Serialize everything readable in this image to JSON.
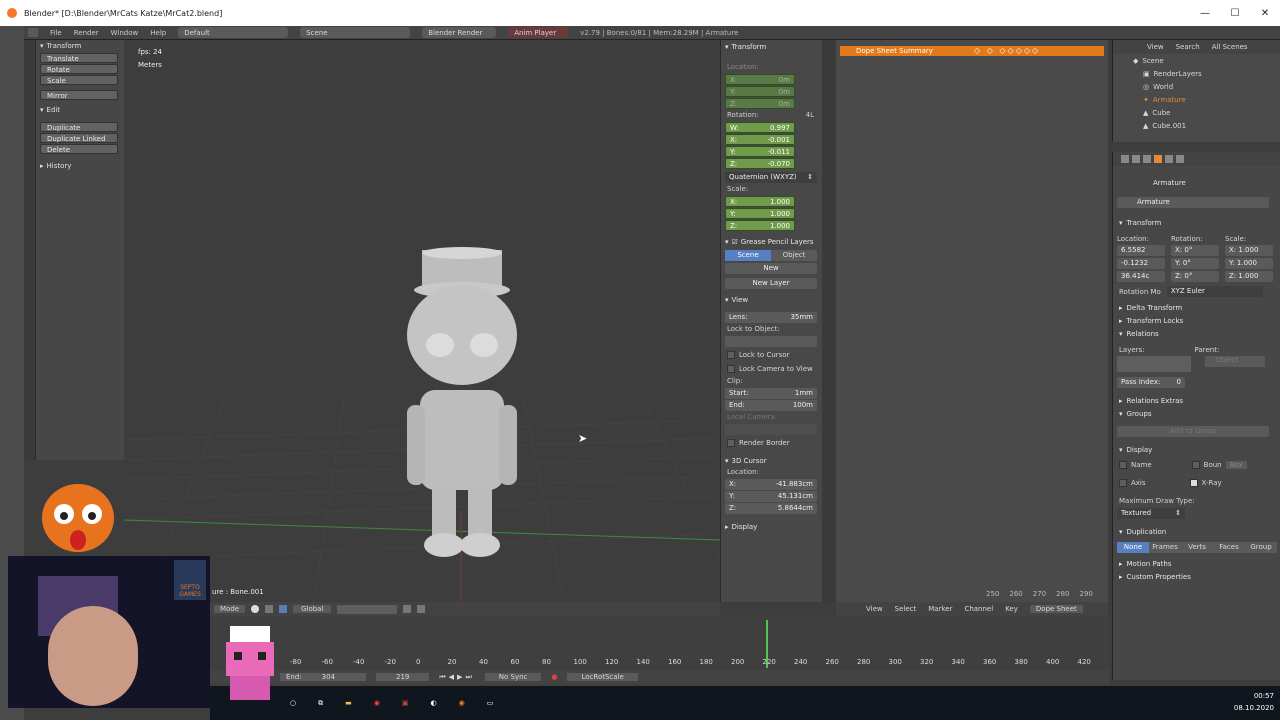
{
  "window": {
    "title": "Blender* [D:\\Blender\\MrCats Katze\\MrCat2.blend]",
    "min": "—",
    "max": "☐",
    "close": "✕"
  },
  "header": {
    "menus": [
      "File",
      "Render",
      "Window",
      "Help"
    ],
    "layout": "Default",
    "scene": "Scene",
    "engine": "Blender Render",
    "anim_player": "Anim Player",
    "stats": "v2.79 | Bones:0/81 | Mem:28.29M | Armature"
  },
  "toolshelf": {
    "transform_title": "Transform",
    "transform_buttons": [
      "Translate",
      "Rotate",
      "Scale"
    ],
    "mirror": "Mirror",
    "edit_title": "Edit",
    "edit_buttons": [
      "Duplicate",
      "Duplicate Linked",
      "Delete"
    ],
    "history_title": "History"
  },
  "viewport": {
    "fps": "fps: 24",
    "units": "Meters",
    "bone_label": "ure : Bone.001",
    "mode": "Mode",
    "orientation": "Global"
  },
  "npanel": {
    "transform_title": "Transform",
    "location_label": "Location:",
    "location": [
      {
        "k": "X:",
        "v": "0m"
      },
      {
        "k": "Y:",
        "v": "0m"
      },
      {
        "k": "Z:",
        "v": "0m"
      }
    ],
    "rotation_label": "Rotation:",
    "rotation_4l": "4L",
    "rotation": [
      {
        "k": "W:",
        "v": "0.997"
      },
      {
        "k": "X:",
        "v": "-0.001"
      },
      {
        "k": "Y:",
        "v": "-0.011"
      },
      {
        "k": "Z:",
        "v": "-0.070"
      }
    ],
    "rotation_mode": "Quaternion (WXYZ)",
    "scale_label": "Scale:",
    "scale": [
      {
        "k": "X:",
        "v": "1.000"
      },
      {
        "k": "Y:",
        "v": "1.000"
      },
      {
        "k": "Z:",
        "v": "1.000"
      }
    ],
    "grease_title": "Grease Pencil Layers",
    "grease_scene": "Scene",
    "grease_object": "Object",
    "grease_new": "New",
    "grease_new_layer": "New Layer",
    "view_title": "View",
    "lens_label": "Lens:",
    "lens_value": "35mm",
    "lock_object": "Lock to Object:",
    "lock_cursor": "Lock to Cursor",
    "lock_camera": "Lock Camera to View",
    "clip_label": "Clip:",
    "clip_start_label": "Start:",
    "clip_start": "1mm",
    "clip_end_label": "End:",
    "clip_end": "100m",
    "local_camera": "Local Camera:",
    "render_border": "Render Border",
    "cursor_title": "3D Cursor",
    "cursor_location": "Location:",
    "cursor": [
      {
        "k": "X:",
        "v": "-41.883cm"
      },
      {
        "k": "Y:",
        "v": "45.131cm"
      },
      {
        "k": "Z:",
        "v": "5.8644cm"
      }
    ],
    "display_title": "Display"
  },
  "dopesheet": {
    "summary": "Dope Sheet Summary",
    "ruler": [
      "250",
      "260",
      "270",
      "280",
      "290"
    ],
    "menus": [
      "View",
      "Select",
      "Marker",
      "Channel",
      "Key"
    ],
    "mode": "Dope Sheet"
  },
  "outliner": {
    "menus": [
      "View",
      "Search",
      "All Scenes"
    ],
    "items": [
      "Scene",
      "RenderLayers",
      "World",
      "Armature",
      "Cube",
      "Cube.001"
    ]
  },
  "properties": {
    "breadcrumb": "Armature",
    "name": "Armature",
    "transform_title": "Transform",
    "location_label": "Location:",
    "rotation_label": "Rotation:",
    "scale_label": "Scale:",
    "location": [
      "6.5582",
      "-0.1232",
      "36.414c"
    ],
    "rotation": [
      "X: 0°",
      "Y: 0°",
      "Z: 0°"
    ],
    "scale": [
      "X: 1.000",
      "Y: 1.000",
      "Z: 1.000"
    ],
    "rotation_mode_label": "Rotation Mo",
    "rotation_mode": "XYZ Euler",
    "sections": [
      "Delta Transform",
      "Transform Locks",
      "Relations"
    ],
    "layers_label": "Layers:",
    "parent_label": "Parent:",
    "parent_object": "Object",
    "pass_index_label": "Pass Index:",
    "pass_index": "0",
    "relations_extras": "Relations Extras",
    "groups": "Groups",
    "add_to_group": "Add to Group",
    "display_title": "Display",
    "name_chk": "Name",
    "axis_chk": "Axis",
    "bounds": "Boun",
    "box": "Box",
    "xray": "X-Ray",
    "max_draw": "Maximum Draw Type:",
    "max_draw_value": "Textured",
    "duplication": "Duplication",
    "dup_buttons": [
      "None",
      "Frames",
      "Verts",
      "Faces",
      "Group"
    ],
    "motion_paths": "Motion Paths",
    "custom_properties": "Custom Properties"
  },
  "timeline": {
    "ruler": [
      "-80",
      "-60",
      "-40",
      "-20",
      "0",
      "20",
      "40",
      "60",
      "80",
      "100",
      "120",
      "140",
      "160",
      "180",
      "200",
      "220",
      "240",
      "260",
      "280",
      "300",
      "320",
      "340",
      "360",
      "380",
      "400",
      "420"
    ],
    "end_label": "End:",
    "end": "304",
    "frame": "219",
    "sync": "No Sync",
    "keying": "LocRotScale"
  },
  "tray": {
    "time": "00:57",
    "date": "08.10.2020"
  },
  "sticker": {
    "text": "SEPTO GAMES"
  }
}
